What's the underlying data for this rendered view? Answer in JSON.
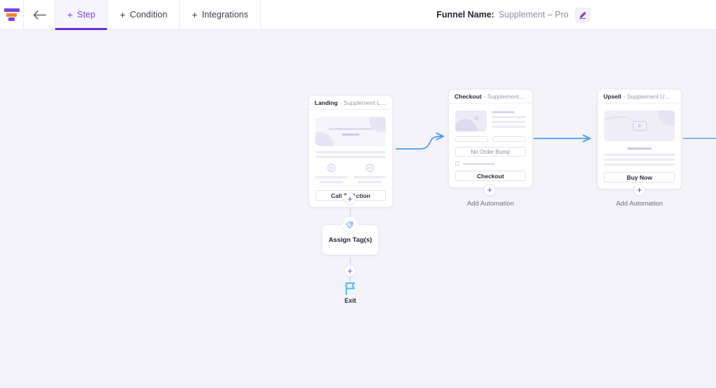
{
  "header": {
    "logo_icon": "funnel-logo-icon",
    "logo_colors": {
      "primary": "#7b3fe4",
      "accent": "#f58220"
    },
    "back_icon": "back-arrow-icon",
    "tabs": [
      {
        "label": "Step",
        "plus": "+",
        "active": true,
        "name": "tab-step"
      },
      {
        "label": "Condition",
        "plus": "+",
        "active": false,
        "name": "tab-condition"
      },
      {
        "label": "Integrations",
        "plus": "+",
        "active": false,
        "name": "tab-integrations"
      }
    ],
    "funnel": {
      "label": "Funnel Name:",
      "value": "Supplement – Pro",
      "edit_icon": "pencil-edit-icon"
    },
    "accent_color": "#7b3fe4"
  },
  "canvas": {
    "background": "#f4f3f9",
    "edge_color": "#4d9bf0",
    "nodes": {
      "landing": {
        "title": "Landing",
        "subtitle": "- Supplement La...",
        "cta_label": "Call To Action",
        "plus": "+"
      },
      "checkout": {
        "title": "Checkout",
        "subtitle": "- Supplement C...",
        "bump_label": "No Order Bump",
        "cta_label": "Checkout",
        "plus": "+",
        "automation_label": "Add Automation"
      },
      "upsell": {
        "title": "Upsell",
        "subtitle": "- Supplement U...",
        "cta_label": "Buy Now",
        "plus": "+",
        "automation_label": "Add Automation",
        "media_icon": "video-play-icon"
      },
      "assign_tag": {
        "label": "Assign Tag(s)",
        "badge_icon": "tag-icon",
        "plus_above": "+",
        "plus_below": "+"
      },
      "exit": {
        "label": "Exit",
        "icon": "flag-icon",
        "icon_color": "#4fc3f7"
      }
    }
  }
}
